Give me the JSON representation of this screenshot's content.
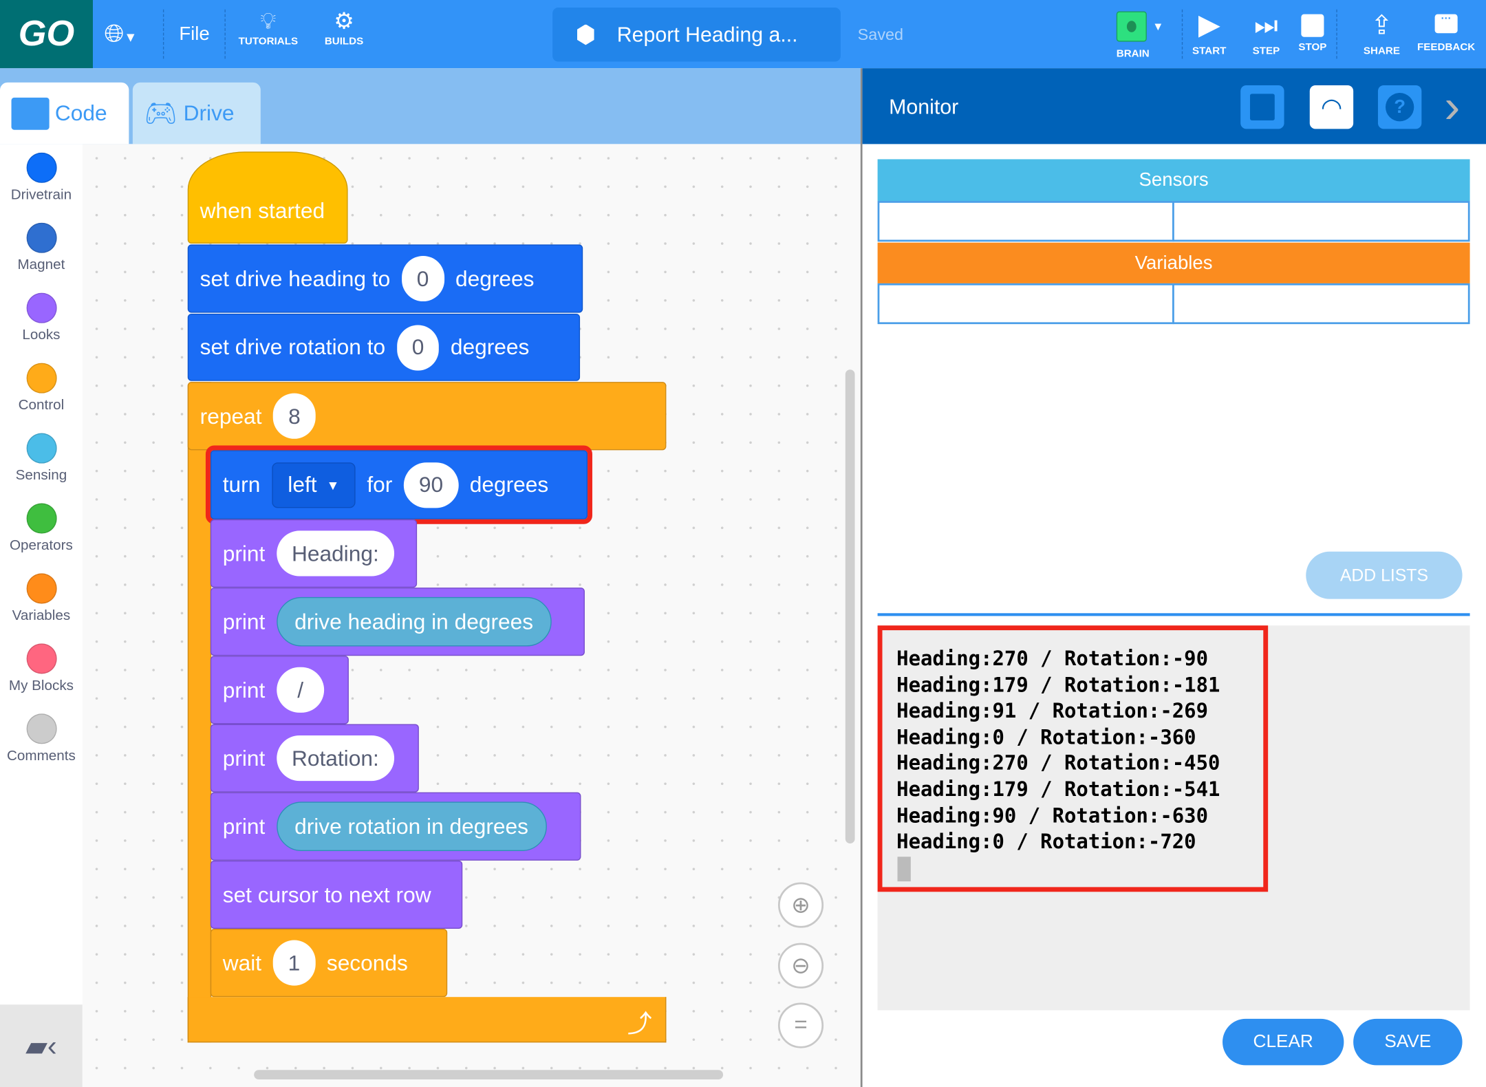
{
  "topbar": {
    "logo": "GO",
    "file_label": "File",
    "tutorials_label": "TUTORIALS",
    "builds_label": "BUILDS",
    "project_title": "Report Heading a...",
    "save_status": "Saved",
    "brain_label": "BRAIN",
    "start_label": "START",
    "step_label": "STEP",
    "stop_label": "STOP",
    "share_label": "SHARE",
    "feedback_label": "FEEDBACK"
  },
  "tabs": {
    "code": "Code",
    "drive": "Drive"
  },
  "categories": [
    {
      "label": "Drivetrain",
      "color": "#0d6ef8"
    },
    {
      "label": "Magnet",
      "color": "#2f6fd0"
    },
    {
      "label": "Looks",
      "color": "#9966ff"
    },
    {
      "label": "Control",
      "color": "#ffab19"
    },
    {
      "label": "Sensing",
      "color": "#4bbde8"
    },
    {
      "label": "Operators",
      "color": "#3fbe3f"
    },
    {
      "label": "Variables",
      "color": "#ff8c1a"
    },
    {
      "label": "My Blocks",
      "color": "#ff6680"
    },
    {
      "label": "Comments",
      "color": "#cccccc"
    }
  ],
  "blocks": {
    "when_started": "when started",
    "set_heading": {
      "pre": "set drive heading to",
      "value": "0",
      "post": "degrees"
    },
    "set_rotation": {
      "pre": "set drive rotation to",
      "value": "0",
      "post": "degrees"
    },
    "repeat": {
      "label": "repeat",
      "value": "8"
    },
    "turn": {
      "pre": "turn",
      "direction": "left",
      "mid": "for",
      "value": "90",
      "post": "degrees"
    },
    "print_label": "print",
    "print1": "Heading:",
    "print2": "drive heading in degrees",
    "print3": "/",
    "print4": "Rotation:",
    "print5": "drive rotation in degrees",
    "set_cursor": "set cursor to next row",
    "wait": {
      "pre": "wait",
      "value": "1",
      "post": "seconds"
    }
  },
  "monitor": {
    "title": "Monitor",
    "sensors": "Sensors",
    "variables": "Variables",
    "add_lists": "ADD LISTS",
    "console_lines": [
      "Heading:270 / Rotation:-90",
      "Heading:179 / Rotation:-181",
      "Heading:91 / Rotation:-269",
      "Heading:0 / Rotation:-360",
      "Heading:270 / Rotation:-450",
      "Heading:179 / Rotation:-541",
      "Heading:90 / Rotation:-630",
      "Heading:0 / Rotation:-720"
    ],
    "clear": "CLEAR",
    "save": "SAVE"
  }
}
